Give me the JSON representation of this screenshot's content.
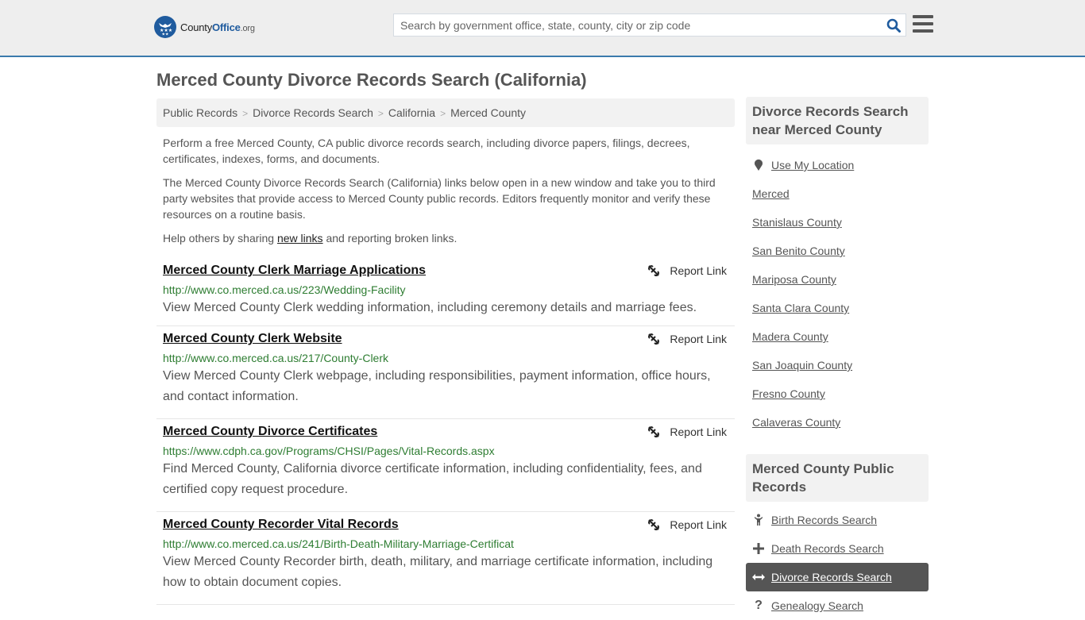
{
  "header": {
    "logo": {
      "brand_main": "County",
      "brand_accent": "Office",
      "brand_tld": ".org"
    },
    "search": {
      "placeholder": "Search by government office, state, county, city or zip code",
      "value": ""
    },
    "accent_color": "#3b7aac"
  },
  "page": {
    "title": "Merced County Divorce Records Search (California)"
  },
  "breadcrumb": [
    {
      "label": "Public Records"
    },
    {
      "label": "Divorce Records Search"
    },
    {
      "label": "California"
    },
    {
      "label": "Merced County"
    }
  ],
  "intro": {
    "p1": "Perform a free Merced County, CA public divorce records search, including divorce papers, filings, decrees, certificates, indexes, forms, and documents.",
    "p2": "The Merced County Divorce Records Search (California) links below open in a new window and take you to third party websites that provide access to Merced County public records. Editors frequently monitor and verify these resources on a routine basis.",
    "p3_before": "Help others by sharing ",
    "p3_link": "new links",
    "p3_after": " and reporting broken links."
  },
  "results": [
    {
      "title": "Merced County Clerk Marriage Applications",
      "url": "http://www.co.merced.ca.us/223/Wedding-Facility",
      "description": "View Merced County Clerk wedding information, including ceremony details and marriage fees.",
      "report_label": "Report Link"
    },
    {
      "title": "Merced County Clerk Website",
      "url": "http://www.co.merced.ca.us/217/County-Clerk",
      "description": "View Merced County Clerk webpage, including responsibilities, payment information, office hours, and contact information.",
      "report_label": "Report Link"
    },
    {
      "title": "Merced County Divorce Certificates",
      "url": "https://www.cdph.ca.gov/Programs/CHSI/Pages/Vital-Records.aspx",
      "description": "Find Merced County, California divorce certificate information, including confidentiality, fees, and certified copy request procedure.",
      "report_label": "Report Link"
    },
    {
      "title": "Merced County Recorder Vital Records",
      "url": "http://www.co.merced.ca.us/241/Birth-Death-Military-Marriage-Certificat",
      "description": "View Merced County Recorder birth, death, military, and marriage certificate information, including how to obtain document copies.",
      "report_label": "Report Link"
    }
  ],
  "sidebar": {
    "nearby": {
      "heading": "Divorce Records Search near Merced County",
      "use_location": "Use My Location",
      "items": [
        "Merced",
        "Stanislaus County",
        "San Benito County",
        "Mariposa County",
        "Santa Clara County",
        "Madera County",
        "San Joaquin County",
        "Fresno County",
        "Calaveras County"
      ]
    },
    "public_records": {
      "heading": "Merced County Public Records",
      "items": [
        {
          "label": "Birth Records Search",
          "icon": "child-icon",
          "active": false
        },
        {
          "label": "Death Records Search",
          "icon": "cross-icon",
          "active": false
        },
        {
          "label": "Divorce Records Search",
          "icon": "arrows-horizontal-icon",
          "active": true
        },
        {
          "label": "Genealogy Search",
          "icon": "question-icon",
          "active": false
        }
      ]
    }
  }
}
